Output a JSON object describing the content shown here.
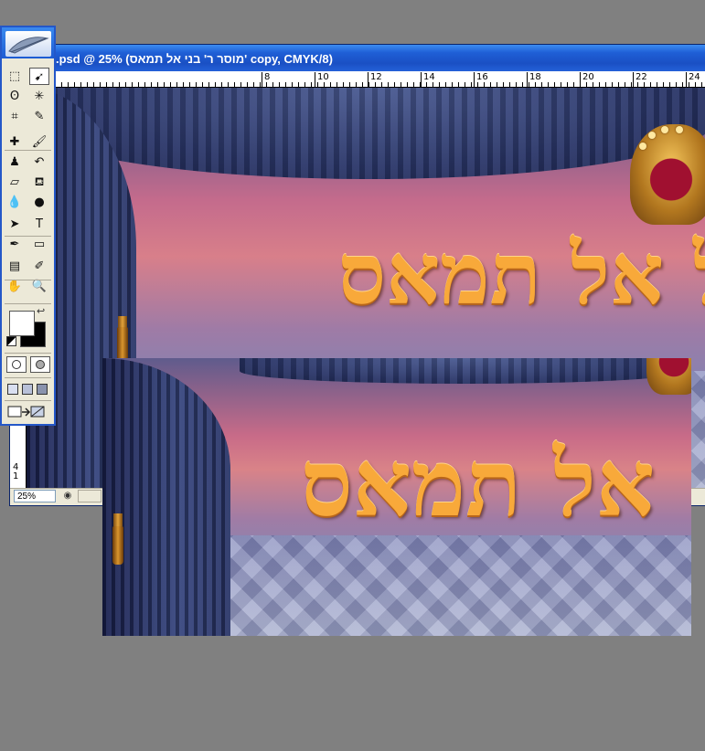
{
  "document": {
    "title": "‎.psd @ 25% (מוסר ר' בני אל תמאס' copy, CMYK/8)",
    "title_visible": ".psd @ 25% (מוסר ר' בני אל תמאס' copy, CMYK/8)",
    "zoom": "25%",
    "ruler_top_numbers": [
      "8",
      "10",
      "12",
      "14",
      "16",
      "18",
      "20",
      "22",
      "24"
    ],
    "ruler_left_numbers": [
      "1",
      "4"
    ]
  },
  "canvas": {
    "hebrew_text": "ל אל תמאס",
    "hebrew_text_front": "אל תמאס"
  },
  "toolbox": {
    "tools": [
      {
        "name": "marquee-tool-icon",
        "glyph": "⬚"
      },
      {
        "name": "move-tool-icon",
        "glyph": "➹"
      },
      {
        "name": "lasso-tool-icon",
        "glyph": "ʘ"
      },
      {
        "name": "magic-wand-tool-icon",
        "glyph": "✳"
      },
      {
        "name": "crop-tool-icon",
        "glyph": "⌗"
      },
      {
        "name": "slice-tool-icon",
        "glyph": "✎"
      },
      {
        "name": "healing-brush-tool-icon",
        "glyph": "✚"
      },
      {
        "name": "brush-tool-icon",
        "glyph": "🖌"
      },
      {
        "name": "clone-stamp-tool-icon",
        "glyph": "♟"
      },
      {
        "name": "history-brush-tool-icon",
        "glyph": "↶"
      },
      {
        "name": "eraser-tool-icon",
        "glyph": "▱"
      },
      {
        "name": "paint-bucket-tool-icon",
        "glyph": "⛾"
      },
      {
        "name": "blur-tool-icon",
        "glyph": "💧"
      },
      {
        "name": "dodge-tool-icon",
        "glyph": "●"
      },
      {
        "name": "path-selection-tool-icon",
        "glyph": "➤"
      },
      {
        "name": "type-tool-icon",
        "glyph": "T"
      },
      {
        "name": "pen-tool-icon",
        "glyph": "✒"
      },
      {
        "name": "rectangle-tool-icon",
        "glyph": "▭"
      },
      {
        "name": "notes-tool-icon",
        "glyph": "▤"
      },
      {
        "name": "eyedropper-tool-icon",
        "glyph": "✐"
      },
      {
        "name": "hand-tool-icon",
        "glyph": "✋"
      },
      {
        "name": "zoom-tool-icon",
        "glyph": "🔍"
      }
    ],
    "colors": {
      "foreground": "#ffffff",
      "background": "#000000"
    }
  },
  "colors": {
    "title_bar": "#1f5fd6",
    "gold_text": "#f8a93a",
    "curtain": "#2b376a"
  }
}
